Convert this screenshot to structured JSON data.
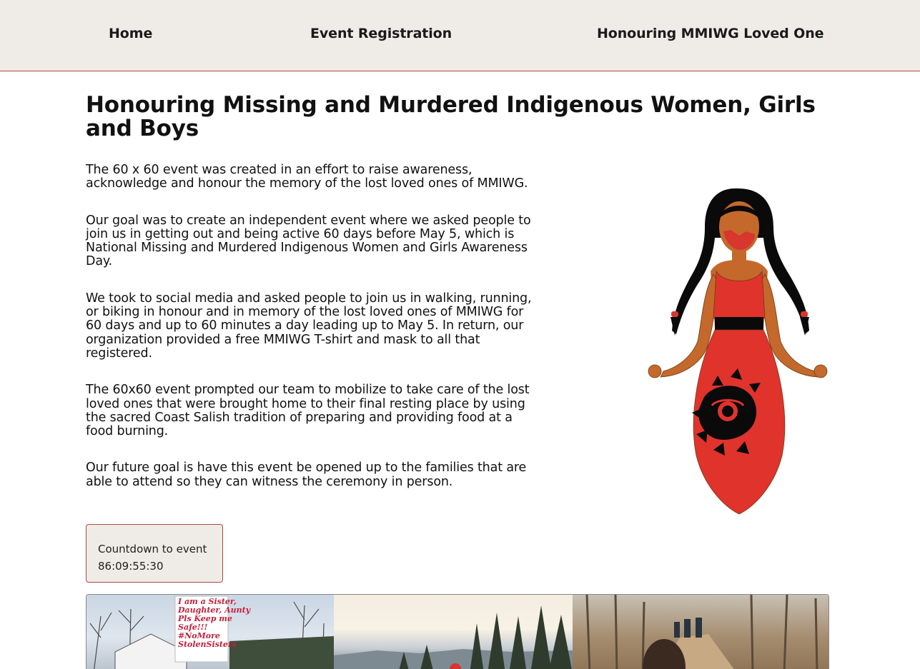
{
  "nav": {
    "items": [
      {
        "label": "Home"
      },
      {
        "label": "Event Registration"
      },
      {
        "label": "Honouring MMIWG Loved One"
      }
    ]
  },
  "page": {
    "title": "Honouring Missing and Murdered Indigenous Women, Girls and Boys",
    "paragraphs": [
      "The 60 x 60 event was created in an effort to raise awareness, acknowledge and honour the memory of the lost loved ones of MMIWG.",
      "Our goal was to create an independent event where we asked people to join us in getting out and being active 60 days before May 5, which is National Missing and Murdered Indigenous Women and Girls Awareness Day.",
      "We took to social media and asked people to join us in walking, running, or biking in honour and in memory of the lost loved ones of MMIWG for 60 days and up to 60 minutes a day leading up to May 5. In return, our organization provided a free MMIWG T-shirt and mask to all that registered.",
      "The 60x60 event prompted our team to mobilize to take care of the lost loved ones that were brought home to their final resting place by using the sacred Coast Salish tradition of preparing and providing food at a food burning.",
      "Our future goal is have this event be opened up to the families that are able to attend so they can witness the ceremony in person."
    ]
  },
  "countdown": {
    "label": "Countdown to event",
    "value": "86:09:55:30"
  },
  "gallery": {
    "sign_lines": [
      "I am a Sister,",
      "Daughter, Aunty",
      "Pls Keep me",
      "Safe!!!",
      "#NoMore",
      "StolenSisters"
    ]
  },
  "colors": {
    "nav_bg": "#efebe7",
    "accent_border": "#a94a4a",
    "dress_red": "#e0332c",
    "skin": "#c4692b"
  }
}
